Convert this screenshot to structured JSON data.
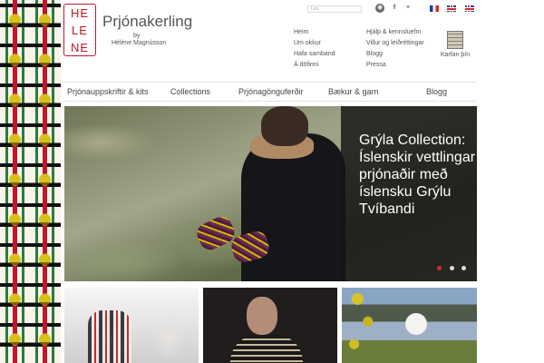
{
  "brand": {
    "logo_letters": [
      "HE",
      "LE",
      "NE"
    ],
    "title": "Prjónakerling",
    "by": "by",
    "author": "Hélène Magnússon"
  },
  "search": {
    "placeholder": "Leit"
  },
  "social_icons": [
    "rss-icon",
    "facebook-icon",
    "twitter-icon"
  ],
  "languages": [
    "flag-fr-icon",
    "flag-uk-icon",
    "flag-is-icon"
  ],
  "top_links_col1": [
    "Heim",
    "Um okkur",
    "Hafa samband",
    "Á döfinni"
  ],
  "top_links_col2": [
    "Hjálp & kennsluefni",
    "Villur og leiðréttingar",
    "Blogg",
    "Pressa"
  ],
  "cart": {
    "label": "Karfan þín"
  },
  "main_nav": [
    "Prjónauppskriftir & kits",
    "Collections",
    "Prjónagönguferðir",
    "Bækur & garn",
    "Blogg"
  ],
  "hero": {
    "caption": "Grýla Collection: Íslenskir vettlingar prjónaðir með íslensku Grýlu Tvíbandi",
    "slides": 3,
    "active_slide": 1
  },
  "colors": {
    "accent": "#c0152a",
    "dot_active": "#d42a2a"
  }
}
